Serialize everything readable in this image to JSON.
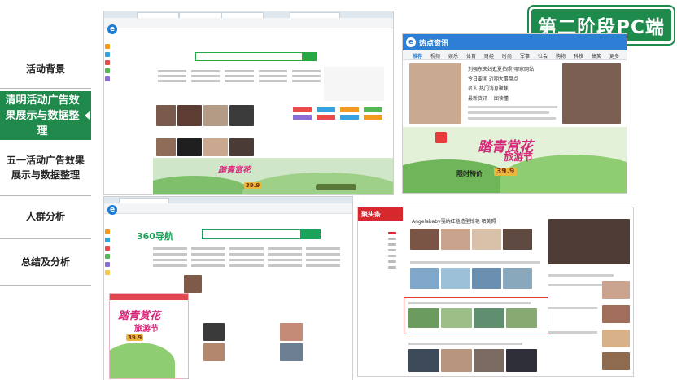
{
  "sidebar": {
    "items": [
      {
        "label": "活动背景"
      },
      {
        "label": "清明活动广告效果展示与数据整理"
      },
      {
        "label": "五一活动广告效果展示与数据整理"
      },
      {
        "label": "人群分析"
      },
      {
        "label": "总结及分析"
      }
    ]
  },
  "stage_badge": "第二阶段PC端",
  "screens": {
    "news_portal": {
      "brand": "热点资讯",
      "nav": [
        "推荐",
        "视频",
        "娱乐",
        "体育",
        "财经",
        "时尚",
        "军事",
        "社会",
        "购物",
        "科技",
        "搞笑",
        "更多"
      ],
      "headlines": [
        "刘强东夫妇逛夏拍照?哪家网站",
        "今日要闻 近期大事盘点",
        "名人 热门消息聚焦",
        "最新资讯 一图读懂"
      ]
    },
    "red_portal": {
      "brand": "聚头条",
      "headline": "Angelababy戛纳红毯造型惊艳 晒美照"
    },
    "ad": {
      "title": "踏青赏花",
      "subtitle": "旅游节",
      "price": "39.9",
      "time_label": "限时特价"
    },
    "nav360": {
      "brand": "360导航"
    }
  },
  "colors": {
    "accent_green": "#1f8a4c",
    "news_blue": "#2d7fd6",
    "alert_red": "#d7282e"
  }
}
